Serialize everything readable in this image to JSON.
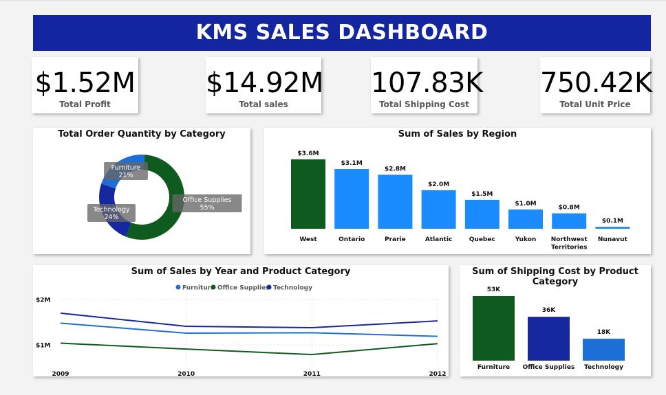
{
  "header": {
    "title": "KMS SALES DASHBOARD"
  },
  "kpis": [
    {
      "value": "$1.52M",
      "label": "Total Profit"
    },
    {
      "value": "$14.92M",
      "label": "Total sales"
    },
    {
      "value": "107.83K",
      "label": "Total Shipping Cost"
    },
    {
      "value": "750.42K",
      "label": "Total Unit Price"
    }
  ],
  "colors": {
    "banner": "#1326a0",
    "furniture": "#1c6fd6",
    "office_supplies": "#0f5a1f",
    "technology": "#1628a0",
    "region_top": "#0f5a1f",
    "region_other": "#1a8cff"
  },
  "chart_data": [
    {
      "type": "pie",
      "title": "Total Order Quantity by Category",
      "donut": true,
      "slices": [
        {
          "label": "Office Supplies",
          "value": 55,
          "display": "55%"
        },
        {
          "label": "Technology",
          "value": 24,
          "display": "24%"
        },
        {
          "label": "Furniture",
          "value": 21,
          "display": "21%"
        }
      ]
    },
    {
      "type": "bar",
      "title": "Sum of Sales by Region",
      "categories": [
        "West",
        "Ontario",
        "Prarie",
        "Atlantic",
        "Quebec",
        "Yukon",
        "Northwest Territories",
        "Nunavut"
      ],
      "category_lines": [
        [
          "West"
        ],
        [
          "Ontario"
        ],
        [
          "Prarie"
        ],
        [
          "Atlantic"
        ],
        [
          "Quebec"
        ],
        [
          "Yukon"
        ],
        [
          "Northwest",
          "Territories"
        ],
        [
          "Nunavut"
        ]
      ],
      "values": [
        3.6,
        3.1,
        2.8,
        2.0,
        1.5,
        1.0,
        0.8,
        0.1
      ],
      "data_labels": [
        "$3.6M",
        "$3.1M",
        "$2.8M",
        "$2.0M",
        "$1.5M",
        "$1.0M",
        "$0.8M",
        "$0.1M"
      ],
      "unit": "$M",
      "ylim": [
        0,
        3.6
      ]
    },
    {
      "type": "line",
      "title": "Sum of Sales by Year and Product Category",
      "x": [
        "2009",
        "2010",
        "2011",
        "2012"
      ],
      "series": [
        {
          "name": "Furniture",
          "values": [
            1.48,
            1.26,
            1.27,
            1.19
          ]
        },
        {
          "name": "Office Supplies",
          "values": [
            1.04,
            0.91,
            0.79,
            1.03
          ]
        },
        {
          "name": "Technology",
          "values": [
            1.7,
            1.41,
            1.38,
            1.53
          ]
        }
      ],
      "yticks": [
        "$2M",
        "$1M"
      ],
      "ytick_values": [
        2,
        1
      ],
      "ylim": [
        0.55,
        2.0
      ],
      "legend_position": "top-center",
      "grid": true
    },
    {
      "type": "bar",
      "title": "Sum of Shipping Cost by Product Category",
      "categories": [
        "Furniture",
        "Office Supplies",
        "Technology"
      ],
      "values": [
        53,
        36,
        18
      ],
      "data_labels": [
        "53K",
        "36K",
        "18K"
      ],
      "unit": "K",
      "ylim": [
        0,
        53
      ]
    }
  ]
}
